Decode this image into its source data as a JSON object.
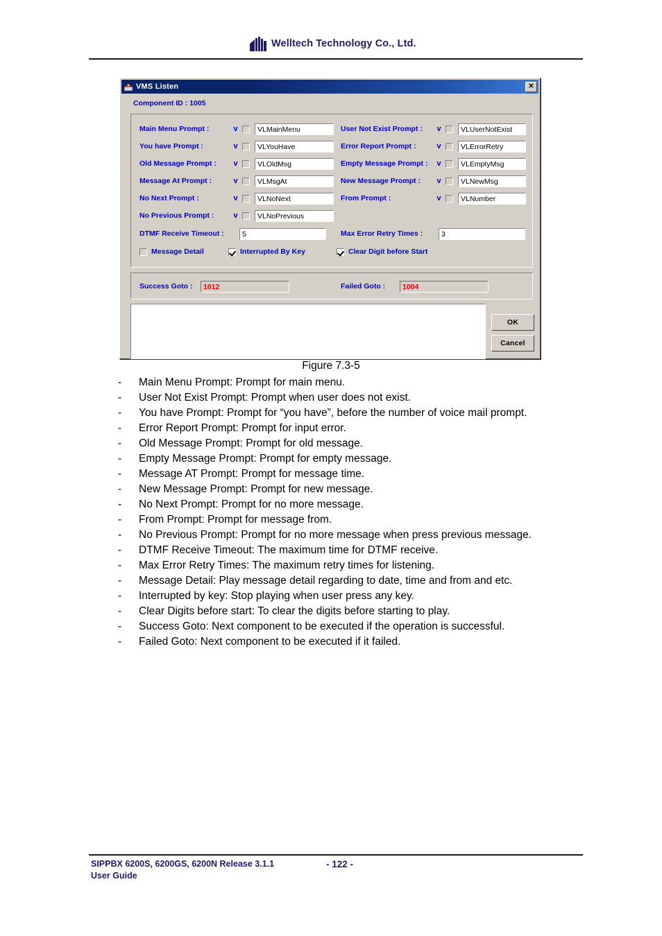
{
  "header": {
    "brand": "Welltech Technology Co., Ltd.",
    "logo_icon": "welltech-building-logo"
  },
  "dialog": {
    "title": "VMS Listen",
    "title_icon": "app-icon",
    "close_label": "✕",
    "component_id": "Component ID : 1005",
    "prompt_fields_left": [
      {
        "label": "Main Menu Prompt :",
        "dropdown_mark": "v",
        "checked": false,
        "value": "VLMainMenu",
        "focused": true
      },
      {
        "label": "You have Prompt :",
        "dropdown_mark": "v",
        "checked": false,
        "value": "VLYouHave",
        "focused": false
      },
      {
        "label": "Old Message Prompt :",
        "dropdown_mark": "v",
        "checked": false,
        "value": "VLOldMsg",
        "focused": false
      },
      {
        "label": "Message At Prompt :",
        "dropdown_mark": "v",
        "checked": false,
        "value": "VLMsgAt",
        "focused": false
      },
      {
        "label": "No Next Prompt :",
        "dropdown_mark": "v",
        "checked": false,
        "value": "VLNoNext",
        "focused": false
      },
      {
        "label": "No Previous Prompt :",
        "dropdown_mark": "v",
        "checked": false,
        "value": "VLNoPrevious",
        "focused": false
      }
    ],
    "prompt_fields_right": [
      {
        "label": "User Not Exist Prompt :",
        "dropdown_mark": "v",
        "checked": false,
        "value": "VLUserNotExist"
      },
      {
        "label": "Error Report Prompt :",
        "dropdown_mark": "v",
        "checked": false,
        "value": "VLErrorRetry"
      },
      {
        "label": "Empty Message Prompt :",
        "dropdown_mark": "v",
        "checked": false,
        "value": "VLEmptyMsg"
      },
      {
        "label": "New Message Prompt :",
        "dropdown_mark": "v",
        "checked": false,
        "value": "VLNewMsg"
      },
      {
        "label": "From Prompt :",
        "dropdown_mark": "v",
        "checked": false,
        "value": "VLNumber"
      }
    ],
    "dtmf_timeout": {
      "label": "DTMF Receive Timeout :",
      "value": "5"
    },
    "max_error_retry": {
      "label": "Max Error Retry Times :",
      "value": "3"
    },
    "options": [
      {
        "label": "Message Detail",
        "checked": false
      },
      {
        "label": "Interrupted By Key",
        "checked": true
      },
      {
        "label": "Clear Digit before Start",
        "checked": true
      }
    ],
    "success_goto": {
      "label": "Success Goto :",
      "value": "1012"
    },
    "failed_goto": {
      "label": "Failed Goto :",
      "value": "1004"
    },
    "log_text": "",
    "ok_label": "OK",
    "cancel_label": "Cancel"
  },
  "figure": {
    "caption": "Figure 7.3-5"
  },
  "body_list": [
    "Main Menu Prompt: Prompt for main menu.",
    "User Not Exist Prompt: Prompt when user does not exist.",
    "You have Prompt: Prompt for “you have”, before the number of voice mail prompt.",
    "Error Report Prompt: Prompt for input error.",
    "Old Message Prompt: Prompt for old message.",
    "Empty Message Prompt: Prompt for empty message.",
    "Message AT Prompt: Prompt for message time.",
    "New Message Prompt: Prompt for new message.",
    "No Next Prompt: Prompt for no more message.",
    "From Prompt: Prompt for message from.",
    "No Previous Prompt: Prompt for no more message when press previous message.",
    "DTMF Receive Timeout: The maximum time for DTMF receive.",
    "Max Error Retry Times: The maximum retry times for listening.",
    "Message Detail: Play message detail regarding to date, time and from and etc.",
    "Interrupted by key: Stop playing when user press any key.",
    "Clear Digits before start: To clear the digits before starting to play.",
    "Success Goto: Next component to be executed if the operation is successful.",
    "Failed Goto: Next component to be executed if it failed."
  ],
  "list_marker": "-",
  "footer": {
    "line1": "SIPPBX 6200S, 6200GS, 6200N Release 3.1.1",
    "line2": "User Guide",
    "page": "- 122 -"
  },
  "colors": {
    "brand_navy": "#201a6e",
    "label_blue": "#0000cc",
    "value_red": "#ee0000",
    "dialog_face": "#d4d0c8",
    "titlebar_blue": "#0a246a"
  }
}
